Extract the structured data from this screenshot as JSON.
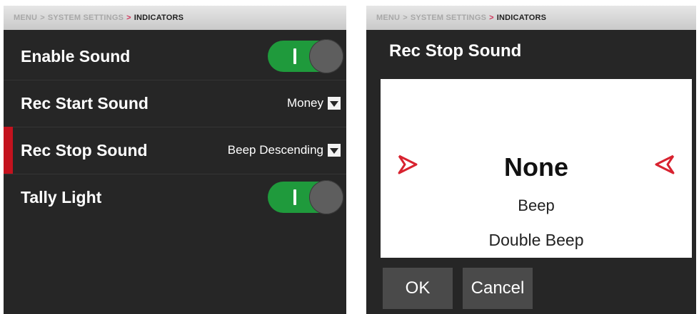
{
  "left": {
    "breadcrumb": {
      "menu": "MENU",
      "sep1": ">",
      "system": "SYSTEM SETTINGS",
      "sep2": ">",
      "current": "INDICATORS"
    },
    "rows": [
      {
        "label": "Enable Sound",
        "toggle": "on"
      },
      {
        "label": "Rec Start Sound",
        "value": "Money"
      },
      {
        "label": "Rec Stop Sound",
        "value": "Beep Descending",
        "selected": true
      },
      {
        "label": "Tally Light",
        "toggle": "on"
      }
    ]
  },
  "right": {
    "breadcrumb": {
      "menu": "MENU",
      "sep1": ">",
      "system": "SYSTEM SETTINGS",
      "sep2": ">",
      "current": "INDICATORS"
    },
    "dialog": {
      "title": "Rec Stop Sound",
      "options": [
        "None",
        "Beep",
        "Double Beep"
      ],
      "selected_option": "None",
      "ok_label": "OK",
      "cancel_label": "Cancel"
    }
  },
  "colors": {
    "accent_red": "#c4121e",
    "toggle_green": "#1f9a3c",
    "panel_bg": "#262626"
  },
  "icons": [
    "chevron-down-icon",
    "arrow-left-icon",
    "arrow-right-icon"
  ]
}
